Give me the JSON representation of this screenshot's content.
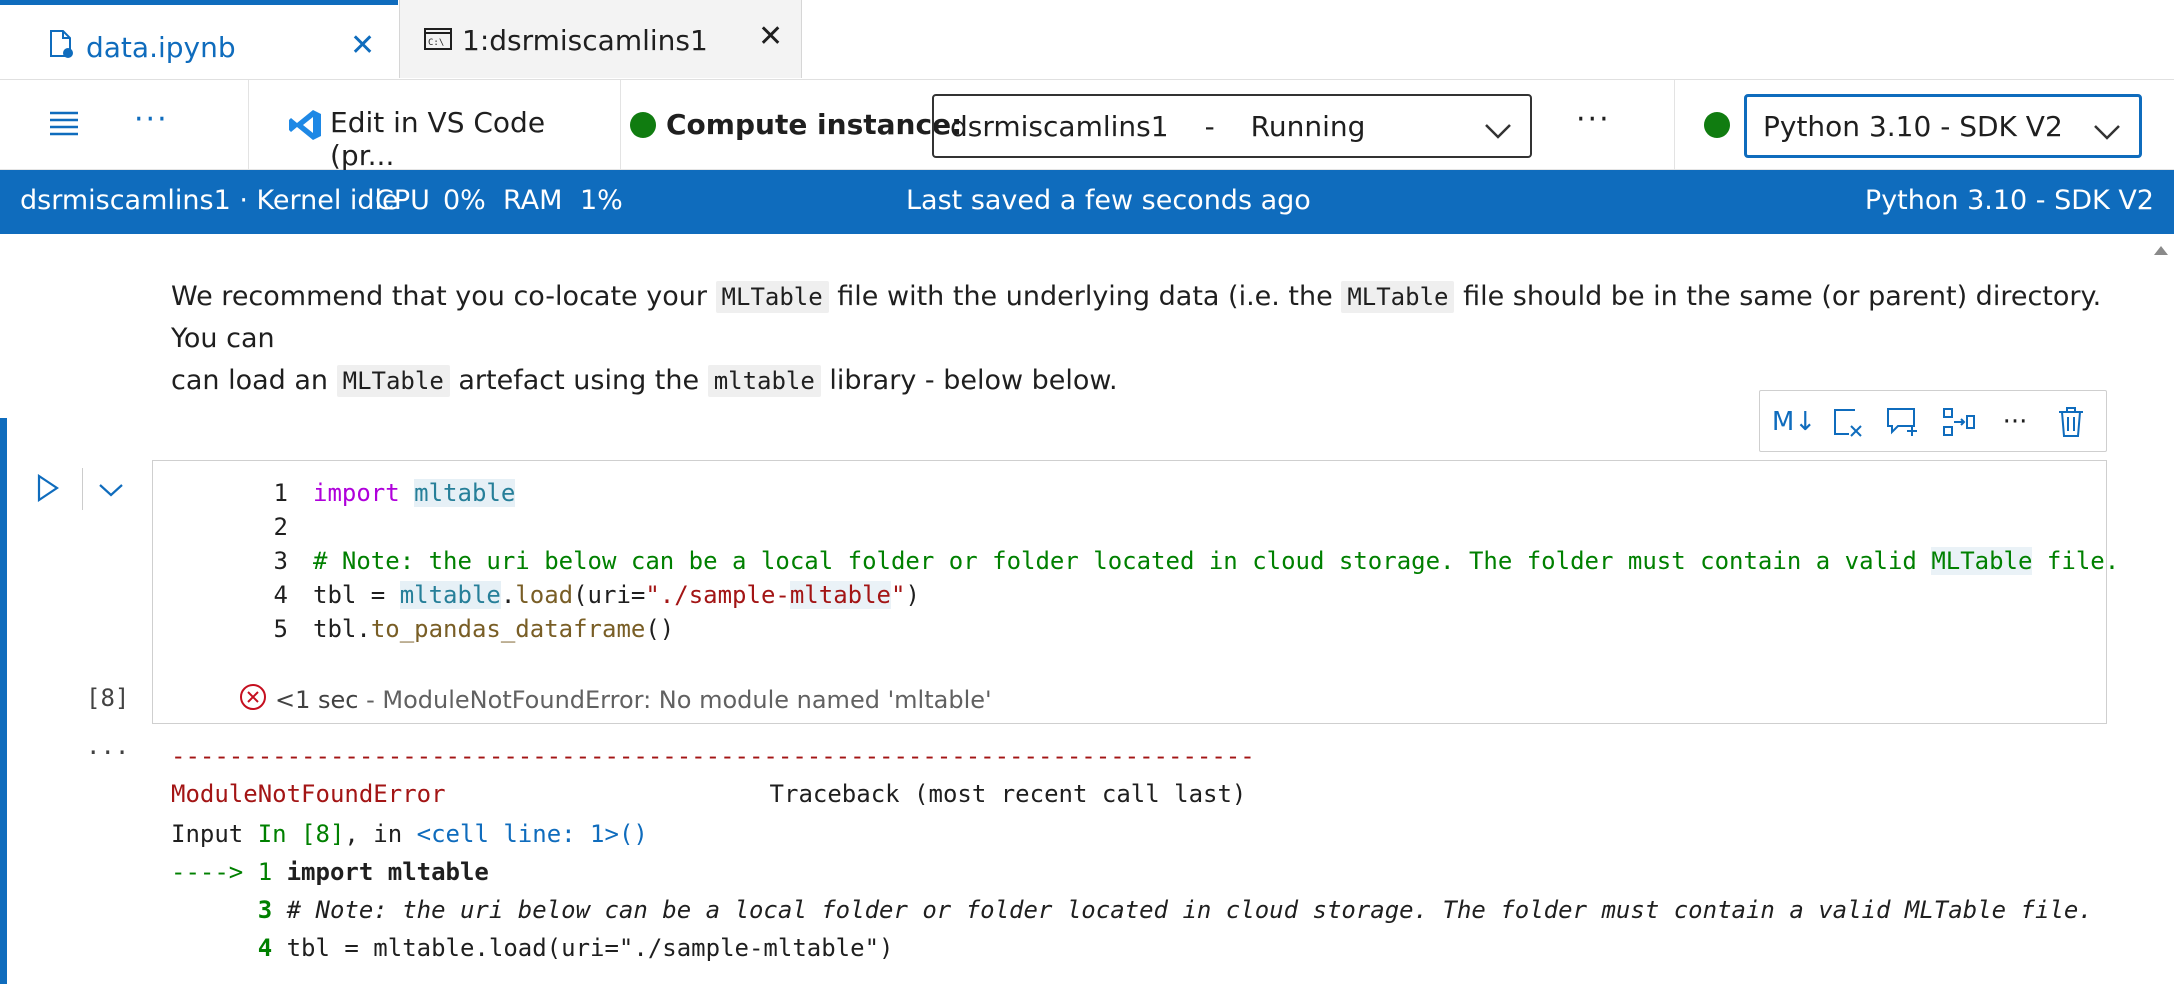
{
  "tabs": [
    {
      "label": "data.ipynb",
      "icon": "notebook-file-icon",
      "active": true
    },
    {
      "label": "1:dsrmiscamlins1",
      "icon": "terminal-icon",
      "active": false
    }
  ],
  "toolbar": {
    "edit_vscode_label": "Edit in VS Code (pr...",
    "compute_label": "Compute instance:",
    "compute_name": "dsrmiscamlins1",
    "compute_sep": "-",
    "compute_status": "Running",
    "kernel_select": "Python 3.10 - SDK V2"
  },
  "statusbar": {
    "left": "dsrmiscamlins1 · Kernel idle",
    "cpu_label": "CPU",
    "cpu_value": "0%",
    "ram_label": "RAM",
    "ram_value": "1%",
    "saved": "Last saved a few seconds ago",
    "kernel": "Python 3.10 - SDK V2"
  },
  "markdown": {
    "t1": "We recommend that you co-locate your ",
    "c1": "MLTable",
    "t2": " file with the underlying data (i.e. the ",
    "c2": "MLTable",
    "t3": " file should be in the same (or parent) directory. You can",
    "t4": "can load an ",
    "c3": "MLTable",
    "t5": " artefact using the ",
    "c4": "mltable",
    "t6": " library - below below."
  },
  "cell_toolbar": {
    "md_label": "M↓"
  },
  "code": {
    "line_numbers": [
      "1",
      "2",
      "3",
      "4",
      "5"
    ],
    "l1_kw": "import",
    "l1_mod": "mltable",
    "l3_a": "# Note: the uri below can be a local folder or folder located in cloud storage. The folder must contain a valid ",
    "l3_b": "MLTable",
    "l3_c": " file.",
    "l4_a": "tbl = ",
    "l4_b": "mltable",
    "l4_c": ".",
    "l4_d": "load",
    "l4_e": "(uri=",
    "l4_f": "\"./sample-",
    "l4_g": "mltable",
    "l4_h": "\"",
    "l4_i": ")",
    "l5_a": "tbl",
    "l5_b": ".",
    "l5_c": "to_pandas_dataframe",
    "l5_d": "()"
  },
  "execution": {
    "count": "[8]",
    "time": "<1 sec",
    "dash": " - ",
    "error": "ModuleNotFoundError: No module named 'mltable'",
    "more": "..."
  },
  "output": {
    "dashes": "---------------------------------------------------------------------------",
    "err_name": "ModuleNotFoundError",
    "traceback": "Traceback (most recent call last)",
    "input_a": "Input ",
    "input_b": "In [8]",
    "input_c": ", in ",
    "input_d": "<cell line: 1>",
    "input_e": "()",
    "arrow": "----> 1 ",
    "arrow_code": "import mltable",
    "l3_num": "      3 ",
    "l3_code": "# Note: the uri below can be a local folder or folder located in cloud storage. The folder must contain a valid MLTable file.",
    "l4_num": "      4 ",
    "l4_code": "tbl = mltable.load(uri=\"./sample-mltable\")"
  }
}
